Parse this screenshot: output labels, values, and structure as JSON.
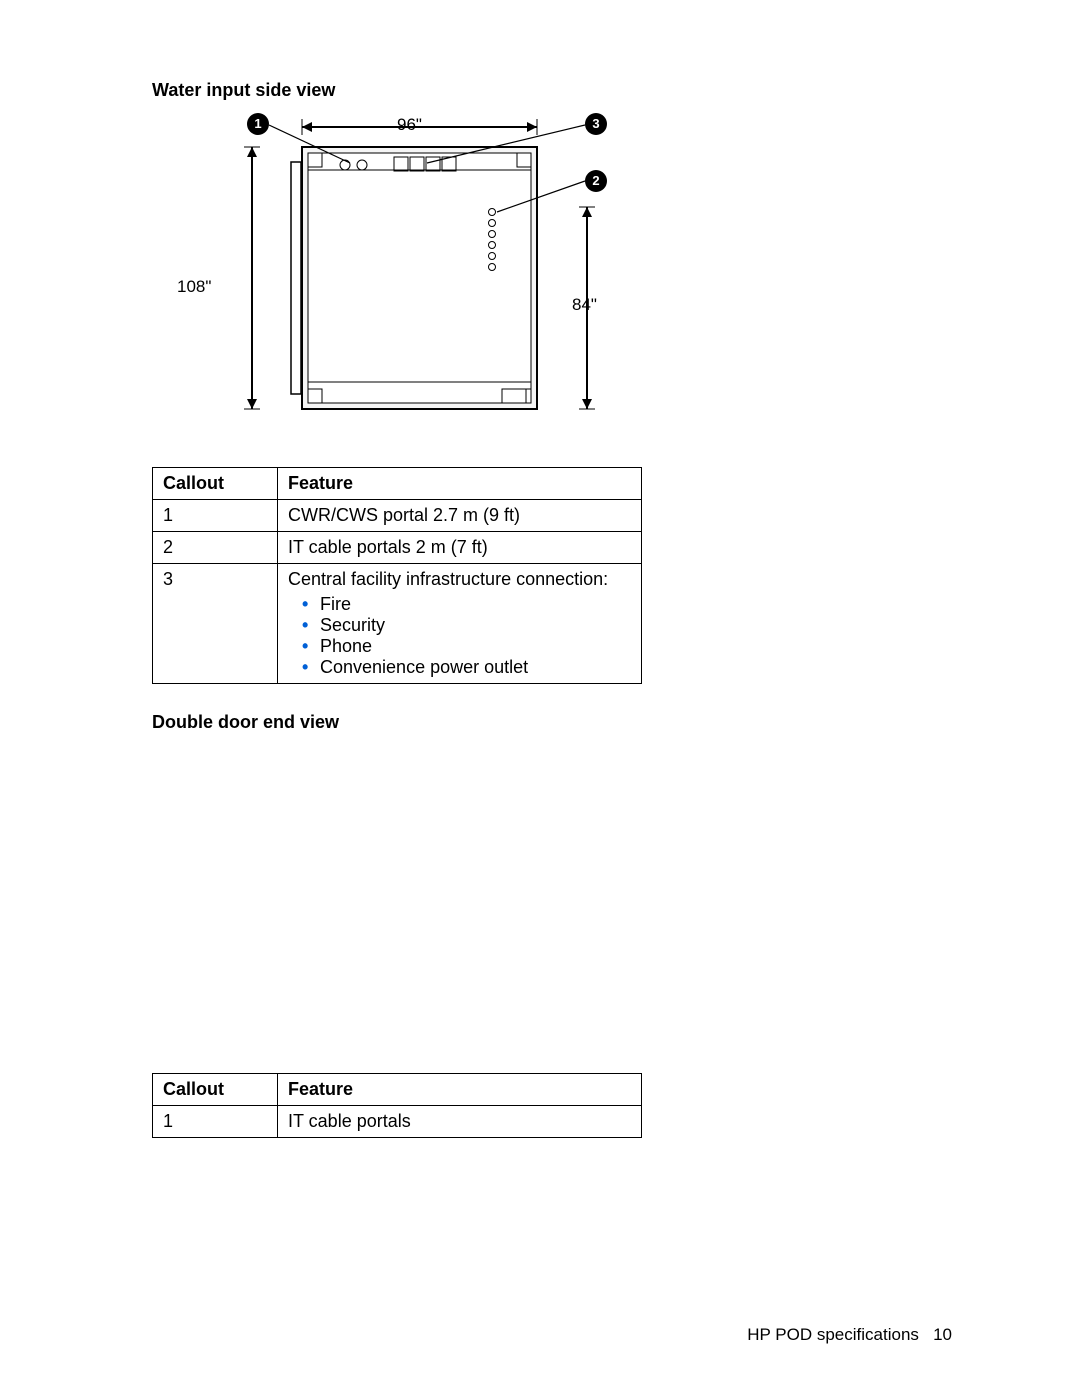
{
  "heading1": "Water input side view",
  "diagram": {
    "width_label": "96\"",
    "height_left_label": "108\"",
    "height_right_label": "84\"",
    "callouts": {
      "c1": "1",
      "c2": "2",
      "c3": "3"
    }
  },
  "table1": {
    "head_callout": "Callout",
    "head_feature": "Feature",
    "rows": [
      {
        "callout": "1",
        "feature": "CWR/CWS portal 2.7 m (9 ft)"
      },
      {
        "callout": "2",
        "feature": "IT cable portals 2 m (7 ft)"
      },
      {
        "callout": "3",
        "feature_intro": "Central facility infrastructure connection:",
        "bullets": [
          "Fire",
          "Security",
          "Phone",
          "Convenience power outlet"
        ]
      }
    ]
  },
  "heading2": "Double door end view",
  "table2": {
    "head_callout": "Callout",
    "head_feature": "Feature",
    "rows": [
      {
        "callout": "1",
        "feature": "IT cable portals"
      }
    ]
  },
  "footer": {
    "text": "HP POD specifications",
    "page": "10"
  }
}
